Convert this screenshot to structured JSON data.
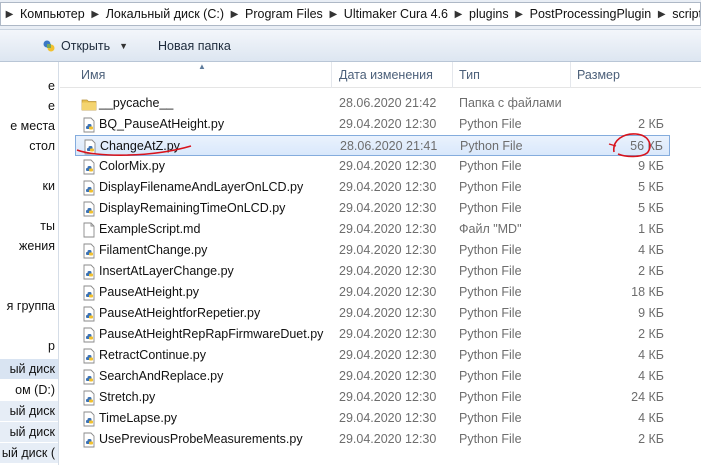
{
  "address": {
    "crumbs": [
      "Компьютер",
      "Локальный диск (C:)",
      "Program Files",
      "Ultimaker Cura 4.6",
      "plugins",
      "PostProcessingPlugin",
      "scripts"
    ]
  },
  "toolbar": {
    "open_label": "Открыть",
    "new_folder_label": "Новая папка"
  },
  "nav": {
    "items": [
      "е",
      "е",
      "е места",
      "стол",
      "",
      "ки",
      "",
      "ты",
      "жения",
      "",
      "",
      "я группа",
      "",
      "р",
      "ый диск",
      "ом (D:)",
      "ый диск",
      "ый диск",
      "ый диск ("
    ]
  },
  "columns": {
    "name": "Имя",
    "date": "Дата изменения",
    "type": "Тип",
    "size": "Размер"
  },
  "files": [
    {
      "name": "__pycache__",
      "date": "28.06.2020 21:42",
      "type": "Папка с файлами",
      "size": "",
      "icon": "folder-icon"
    },
    {
      "name": "BQ_PauseAtHeight.py",
      "date": "29.04.2020 12:30",
      "type": "Python File",
      "size": "2 КБ",
      "icon": "python-file-icon"
    },
    {
      "name": "ChangeAtZ.py",
      "date": "28.06.2020 21:41",
      "type": "Python File",
      "size": "56 КБ",
      "icon": "python-file-icon"
    },
    {
      "name": "ColorMix.py",
      "date": "29.04.2020 12:30",
      "type": "Python File",
      "size": "9 КБ",
      "icon": "python-file-icon"
    },
    {
      "name": "DisplayFilenameAndLayerOnLCD.py",
      "date": "29.04.2020 12:30",
      "type": "Python File",
      "size": "5 КБ",
      "icon": "python-file-icon"
    },
    {
      "name": "DisplayRemainingTimeOnLCD.py",
      "date": "29.04.2020 12:30",
      "type": "Python File",
      "size": "5 КБ",
      "icon": "python-file-icon"
    },
    {
      "name": "ExampleScript.md",
      "date": "29.04.2020 12:30",
      "type": "Файл \"MD\"",
      "size": "1 КБ",
      "icon": "generic-file-icon"
    },
    {
      "name": "FilamentChange.py",
      "date": "29.04.2020 12:30",
      "type": "Python File",
      "size": "4 КБ",
      "icon": "python-file-icon"
    },
    {
      "name": "InsertAtLayerChange.py",
      "date": "29.04.2020 12:30",
      "type": "Python File",
      "size": "2 КБ",
      "icon": "python-file-icon"
    },
    {
      "name": "PauseAtHeight.py",
      "date": "29.04.2020 12:30",
      "type": "Python File",
      "size": "18 КБ",
      "icon": "python-file-icon"
    },
    {
      "name": "PauseAtHeightforRepetier.py",
      "date": "29.04.2020 12:30",
      "type": "Python File",
      "size": "9 КБ",
      "icon": "python-file-icon"
    },
    {
      "name": "PauseAtHeightRepRapFirmwareDuet.py",
      "date": "29.04.2020 12:30",
      "type": "Python File",
      "size": "2 КБ",
      "icon": "python-file-icon"
    },
    {
      "name": "RetractContinue.py",
      "date": "29.04.2020 12:30",
      "type": "Python File",
      "size": "4 КБ",
      "icon": "python-file-icon"
    },
    {
      "name": "SearchAndReplace.py",
      "date": "29.04.2020 12:30",
      "type": "Python File",
      "size": "4 КБ",
      "icon": "python-file-icon"
    },
    {
      "name": "Stretch.py",
      "date": "29.04.2020 12:30",
      "type": "Python File",
      "size": "24 КБ",
      "icon": "python-file-icon"
    },
    {
      "name": "TimeLapse.py",
      "date": "29.04.2020 12:30",
      "type": "Python File",
      "size": "4 КБ",
      "icon": "python-file-icon"
    },
    {
      "name": "UsePreviousProbeMeasurements.py",
      "date": "29.04.2020 12:30",
      "type": "Python File",
      "size": "2 КБ",
      "icon": "python-file-icon"
    }
  ],
  "selected_index": 2,
  "colors": {
    "annotation": "#d8131c",
    "selection_border": "#84acdd"
  }
}
